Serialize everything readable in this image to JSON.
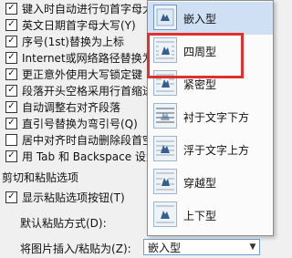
{
  "options": [
    {
      "label": "键入时自动进行句首字母大写",
      "checked": true
    },
    {
      "label": "英文日期首字母大写(Y)",
      "checked": true
    },
    {
      "label": "序号(1st)替换为上标",
      "checked": true
    },
    {
      "label": "Internet或网络路径替换为超链接",
      "checked": true
    },
    {
      "label": "更正意外使用大写锁定键",
      "checked": true
    },
    {
      "label": "段落开头空格采用行首缩进",
      "checked": true
    },
    {
      "label": "自动调整右对齐段落",
      "checked": true
    },
    {
      "label": "直引号替换为弯引号(Q)",
      "checked": true
    },
    {
      "label": "居中对齐时自动删除段首空格",
      "checked": false
    },
    {
      "label": "用 Tab 和 Backspace 设置左缩进",
      "checked": true
    }
  ],
  "paste_section": {
    "title": "剪切和粘贴选项",
    "show_button": {
      "label": "显示粘贴选项按钮(T)",
      "checked": true
    },
    "default_paste_label": "默认粘贴方式(D):",
    "insert_picture_label": "将图片插入/粘贴为(Z):",
    "insert_picture_value": "嵌入型",
    "dropdown_arrow": "▼"
  },
  "wrap_menu": {
    "items": [
      {
        "label": "嵌入型",
        "icon": "inline-wrap-icon",
        "highlighted": true
      },
      {
        "label": "四周型",
        "icon": "square-wrap-icon",
        "highlighted": false
      },
      {
        "label": "紧密型",
        "icon": "tight-wrap-icon",
        "highlighted": false
      },
      {
        "label": "衬于文字下方",
        "icon": "behind-text-icon",
        "highlighted": false
      },
      {
        "label": "浮于文字上方",
        "icon": "in-front-text-icon",
        "highlighted": false
      },
      {
        "label": "穿越型",
        "icon": "through-wrap-icon",
        "highlighted": false
      },
      {
        "label": "上下型",
        "icon": "top-bottom-wrap-icon",
        "highlighted": false
      }
    ],
    "annotation_color": "#e0312b",
    "highlight_color": "#cfe0f4"
  }
}
